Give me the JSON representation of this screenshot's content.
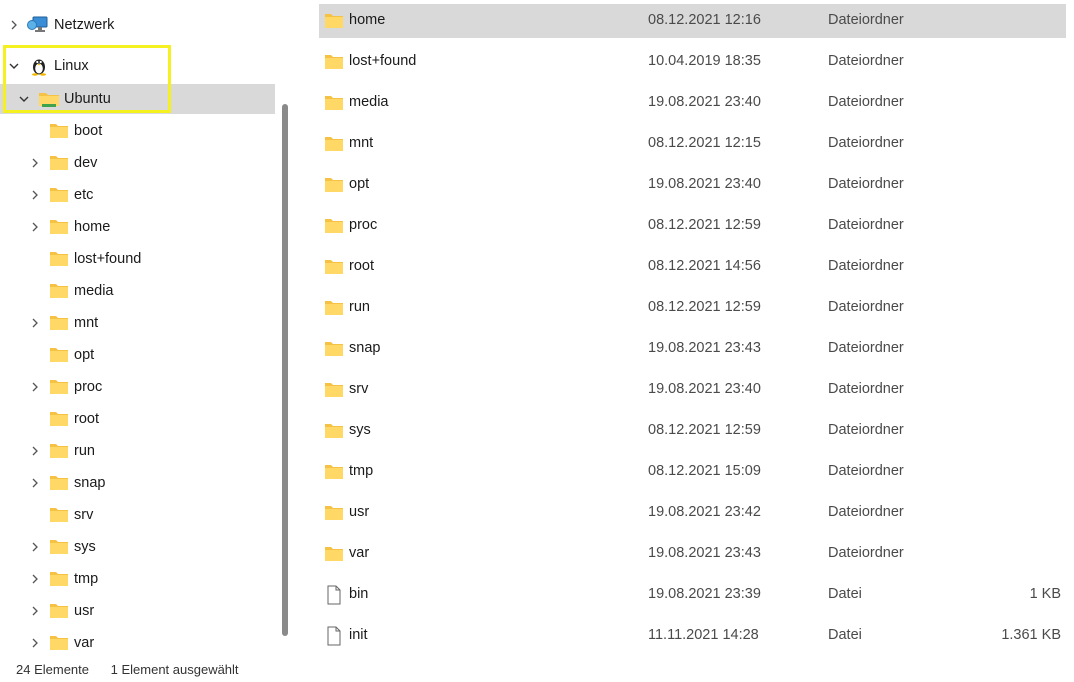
{
  "nav": {
    "network": {
      "label": "Netzwerk",
      "icon": "network-icon"
    },
    "linux": {
      "label": "Linux",
      "icon": "tux-penguin-icon"
    },
    "ubuntu": {
      "label": "Ubuntu",
      "icon": "distro-folder-icon"
    },
    "folders": [
      {
        "label": "boot",
        "expandable": false
      },
      {
        "label": "dev",
        "expandable": true
      },
      {
        "label": "etc",
        "expandable": true
      },
      {
        "label": "home",
        "expandable": true
      },
      {
        "label": "lost+found",
        "expandable": false
      },
      {
        "label": "media",
        "expandable": false
      },
      {
        "label": "mnt",
        "expandable": true
      },
      {
        "label": "opt",
        "expandable": false
      },
      {
        "label": "proc",
        "expandable": true
      },
      {
        "label": "root",
        "expandable": false
      },
      {
        "label": "run",
        "expandable": true
      },
      {
        "label": "snap",
        "expandable": true
      },
      {
        "label": "srv",
        "expandable": false
      },
      {
        "label": "sys",
        "expandable": true
      },
      {
        "label": "tmp",
        "expandable": true
      },
      {
        "label": "usr",
        "expandable": true
      },
      {
        "label": "var",
        "expandable": true
      }
    ]
  },
  "files": [
    {
      "name": "home",
      "date": "08.12.2021 12:16",
      "type": "Dateiordner",
      "size": "",
      "kind": "folder",
      "selected": true
    },
    {
      "name": "lost+found",
      "date": "10.04.2019 18:35",
      "type": "Dateiordner",
      "size": "",
      "kind": "folder"
    },
    {
      "name": "media",
      "date": "19.08.2021 23:40",
      "type": "Dateiordner",
      "size": "",
      "kind": "folder"
    },
    {
      "name": "mnt",
      "date": "08.12.2021 12:15",
      "type": "Dateiordner",
      "size": "",
      "kind": "folder"
    },
    {
      "name": "opt",
      "date": "19.08.2021 23:40",
      "type": "Dateiordner",
      "size": "",
      "kind": "folder"
    },
    {
      "name": "proc",
      "date": "08.12.2021 12:59",
      "type": "Dateiordner",
      "size": "",
      "kind": "folder"
    },
    {
      "name": "root",
      "date": "08.12.2021 14:56",
      "type": "Dateiordner",
      "size": "",
      "kind": "folder"
    },
    {
      "name": "run",
      "date": "08.12.2021 12:59",
      "type": "Dateiordner",
      "size": "",
      "kind": "folder"
    },
    {
      "name": "snap",
      "date": "19.08.2021 23:43",
      "type": "Dateiordner",
      "size": "",
      "kind": "folder"
    },
    {
      "name": "srv",
      "date": "19.08.2021 23:40",
      "type": "Dateiordner",
      "size": "",
      "kind": "folder"
    },
    {
      "name": "sys",
      "date": "08.12.2021 12:59",
      "type": "Dateiordner",
      "size": "",
      "kind": "folder"
    },
    {
      "name": "tmp",
      "date": "08.12.2021 15:09",
      "type": "Dateiordner",
      "size": "",
      "kind": "folder"
    },
    {
      "name": "usr",
      "date": "19.08.2021 23:42",
      "type": "Dateiordner",
      "size": "",
      "kind": "folder"
    },
    {
      "name": "var",
      "date": "19.08.2021 23:43",
      "type": "Dateiordner",
      "size": "",
      "kind": "folder"
    },
    {
      "name": "bin",
      "date": "19.08.2021 23:39",
      "type": "Datei",
      "size": "1 KB",
      "kind": "file"
    },
    {
      "name": "init",
      "date": "11.11.2021 14:28",
      "type": "Datei",
      "size": "1.361 KB",
      "kind": "file"
    }
  ],
  "status": {
    "count": "24 Elemente",
    "selection": "1 Element ausgewählt"
  },
  "colors": {
    "selection": "#d9d9d9",
    "highlight": "#f5f020",
    "folder": "#f6c243",
    "folder_front": "#ffd866"
  }
}
